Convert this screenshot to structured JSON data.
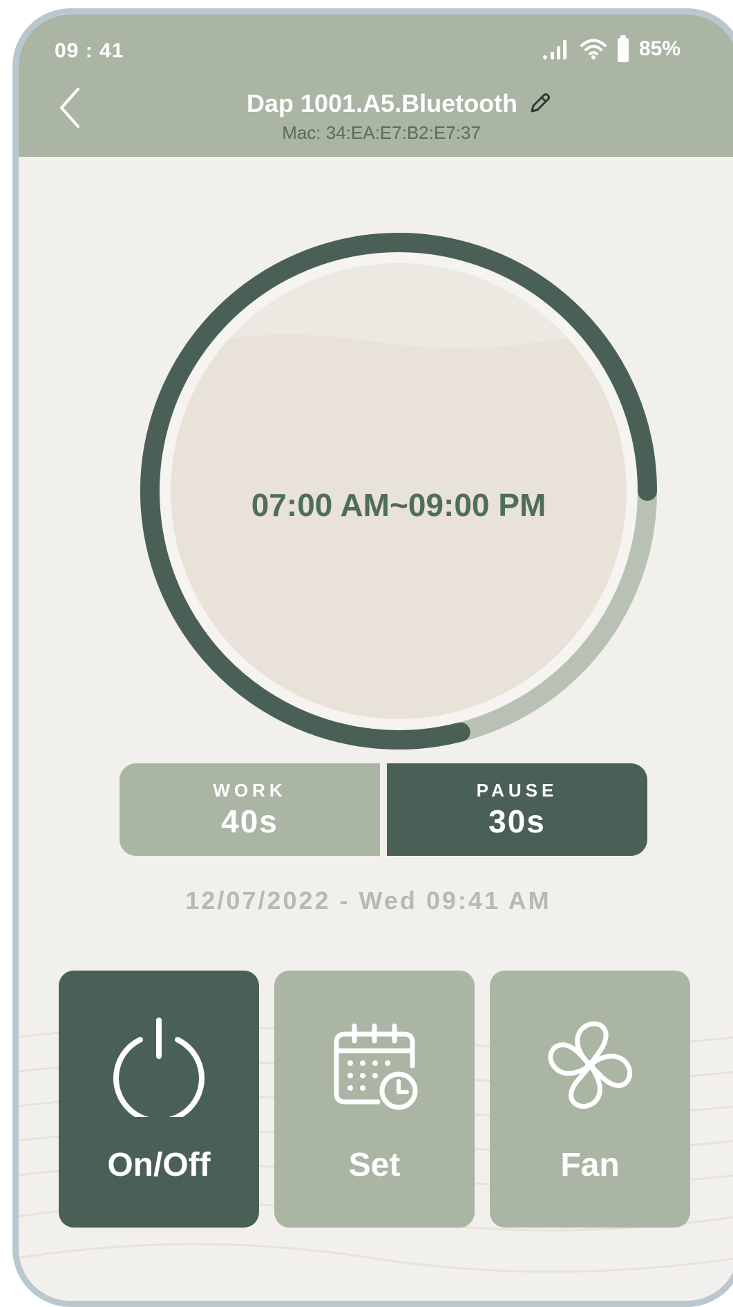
{
  "status_bar": {
    "time": "09 : 41",
    "battery": "85%"
  },
  "header": {
    "title": "Dap 1001.A5.Bluetooth",
    "mac": "Mac: 34:EA:E7:B2:E7:37"
  },
  "schedule": {
    "time_range": "07:00 AM~09:00 PM",
    "progress_fraction": 0.79
  },
  "cycle": {
    "work_label": "WORK",
    "work_value": "40s",
    "pause_label": "PAUSE",
    "pause_value": "30s",
    "selected": "pause"
  },
  "datetime": "12/07/2022  -  Wed 09:41 AM",
  "actions": [
    {
      "label": "On/Off",
      "icon": "power-icon",
      "active": true
    },
    {
      "label": "Set",
      "icon": "calendar-clock-icon",
      "active": false
    },
    {
      "label": "Fan",
      "icon": "fan-icon",
      "active": false
    }
  ],
  "colors": {
    "header": "#aab5a4",
    "dark_accent": "#4a6057",
    "light_accent": "#aab5a4",
    "background": "#f2f0ec",
    "ring_track": "#b9c1b4",
    "time_text": "#4f6e59"
  }
}
